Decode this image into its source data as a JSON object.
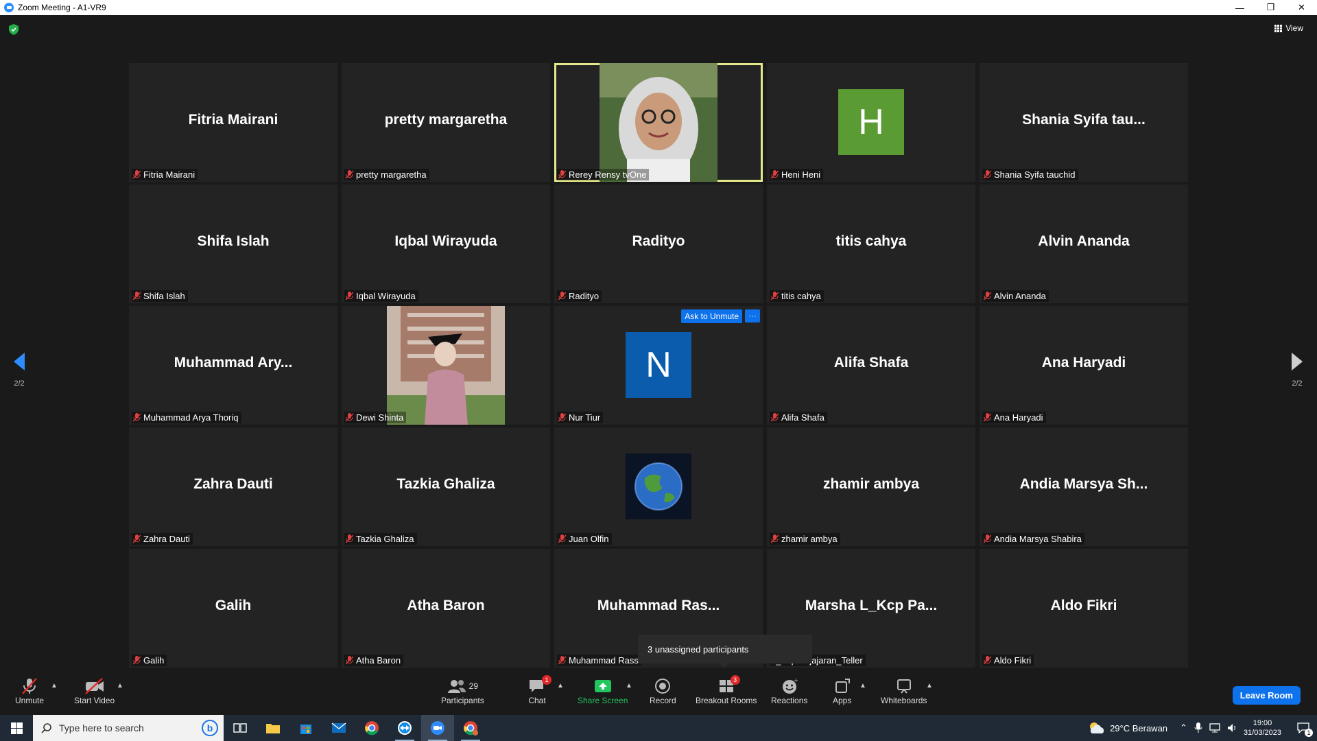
{
  "window": {
    "title": "Zoom Meeting - A1-VR9"
  },
  "toolbar_top": {
    "view_label": "View"
  },
  "pager": {
    "left_label": "2/2",
    "right_label": "2/2"
  },
  "tiles": [
    {
      "display": "Fitria Mairani",
      "name": "Fitria Mairani"
    },
    {
      "display": "pretty margaretha",
      "name": "pretty margaretha"
    },
    {
      "display": "",
      "name": "Rerey Rensy tvOne"
    },
    {
      "display": "",
      "name": "Heni Heni",
      "avatar": "H"
    },
    {
      "display": "Shania  Syifa  tau...",
      "name": "Shania Syifa tauchid"
    },
    {
      "display": "Shifa Islah",
      "name": "Shifa Islah"
    },
    {
      "display": "Iqbal Wirayuda",
      "name": "Iqbal Wirayuda"
    },
    {
      "display": "Radityo",
      "name": "Radityo"
    },
    {
      "display": "titis cahya",
      "name": "titis cahya"
    },
    {
      "display": "Alvin Ananda",
      "name": "Alvin Ananda"
    },
    {
      "display": "Muhammad  Ary...",
      "name": "Muhammad Arya Thoriq"
    },
    {
      "display": "",
      "name": "Dewi Shinta"
    },
    {
      "display": "",
      "name": "Nur Tiur",
      "avatar": "N",
      "ask_unmute": "Ask to Unmute",
      "more": "···"
    },
    {
      "display": "Alifa Shafa",
      "name": "Alifa Shafa"
    },
    {
      "display": "Ana Haryadi",
      "name": "Ana Haryadi"
    },
    {
      "display": "Zahra Dauti",
      "name": "Zahra Dauti"
    },
    {
      "display": "Tazkia Ghaliza",
      "name": "Tazkia Ghaliza"
    },
    {
      "display": "",
      "name": "Juan Olfin"
    },
    {
      "display": "zhamir ambya",
      "name": "zhamir ambya"
    },
    {
      "display": "Andia  Marsya  Sh...",
      "name": "Andia Marsya Shabira"
    },
    {
      "display": "Galih",
      "name": "Galih"
    },
    {
      "display": "Atha Baron",
      "name": "Atha Baron"
    },
    {
      "display": "Muhammad  Ras...",
      "name": "Muhammad Rass"
    },
    {
      "display": "Marsha  L_Kcp  Pa...",
      "name": "L_Kcp Pajajaran_Teller"
    },
    {
      "display": "Aldo Fikri",
      "name": "Aldo Fikri"
    }
  ],
  "breakout_popup": {
    "text": "3 unassigned participants"
  },
  "controls": {
    "unmute": "Unmute",
    "start_video": "Start Video",
    "participants": "Participants",
    "participants_count": "29",
    "chat": "Chat",
    "chat_badge": "1",
    "share_screen": "Share Screen",
    "record": "Record",
    "breakout_rooms": "Breakout Rooms",
    "breakout_badge": "3",
    "reactions": "Reactions",
    "apps": "Apps",
    "whiteboards": "Whiteboards",
    "leave": "Leave Room"
  },
  "taskbar": {
    "search_placeholder": "Type here to search",
    "weather": "29°C  Berawan",
    "time": "19:00",
    "date": "31/03/2023",
    "notif_count": "1"
  },
  "colors": {
    "accent": "#0e72ed",
    "active_border": "#e5e88a",
    "share_green": "#22c55e",
    "avatar_h": "#5a9b34",
    "avatar_n": "#0b5cad"
  }
}
